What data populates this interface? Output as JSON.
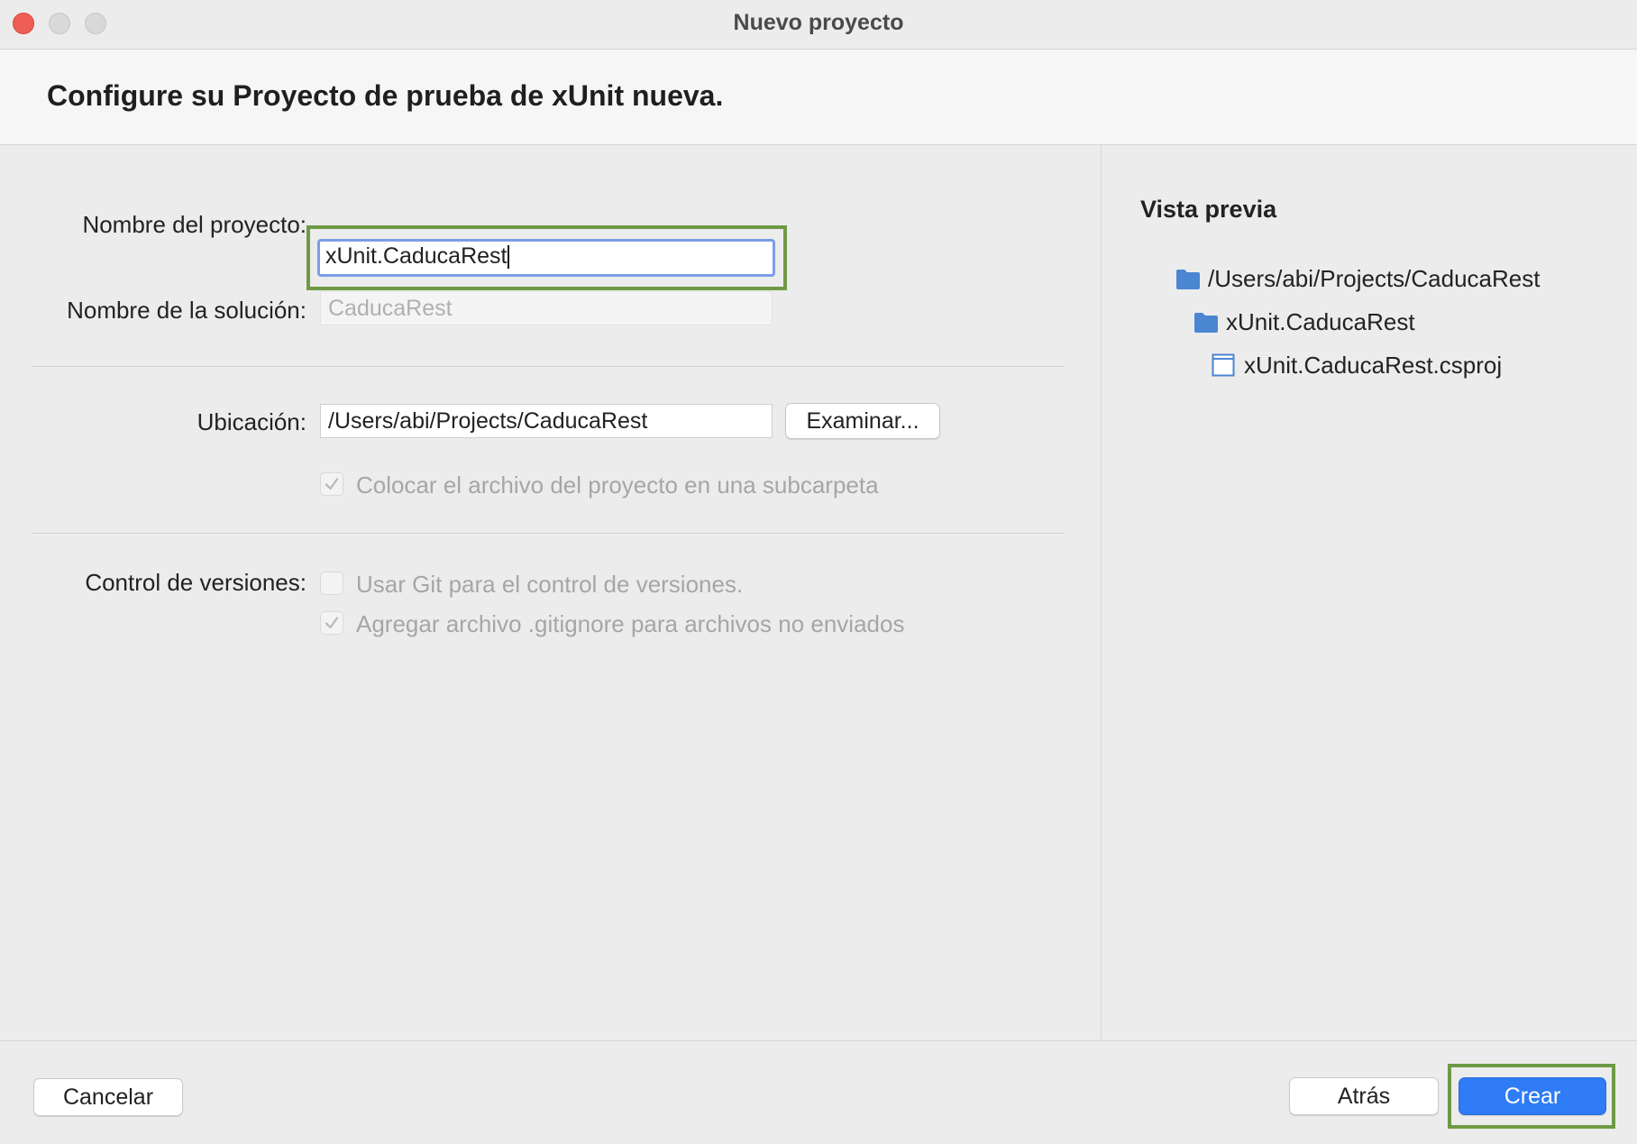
{
  "window": {
    "title": "Nuevo proyecto"
  },
  "header": {
    "title": "Configure su Proyecto de prueba de xUnit nueva."
  },
  "form": {
    "project_name_label": "Nombre del proyecto:",
    "project_name_value": "xUnit.CaducaRest",
    "solution_name_label": "Nombre de la solución:",
    "solution_name_value": "CaducaRest",
    "location_label": "Ubicación:",
    "location_value": "/Users/abi/Projects/CaducaRest",
    "browse_button": "Examinar...",
    "subfolder_checkbox": {
      "label": "Colocar el archivo del proyecto en una subcarpeta",
      "checked": true,
      "enabled": false
    },
    "version_control_label": "Control de versiones:",
    "git_checkbox": {
      "label": "Usar Git para el control de versiones.",
      "checked": false,
      "enabled": false
    },
    "gitignore_checkbox": {
      "label": "Agregar archivo .gitignore para archivos no enviados",
      "checked": true,
      "enabled": false
    }
  },
  "preview": {
    "title": "Vista previa",
    "items": [
      {
        "label": "/Users/abi/Projects/CaducaRest",
        "icon": "folder-icon"
      },
      {
        "label": "xUnit.CaducaRest",
        "icon": "folder-icon"
      },
      {
        "label": "xUnit.CaducaRest.csproj",
        "icon": "file-icon"
      }
    ]
  },
  "footer": {
    "cancel_button": "Cancelar",
    "back_button": "Atrás",
    "create_button": "Crear"
  },
  "colors": {
    "accent": "#2f7cf6",
    "highlight": "#6f9a45",
    "focus_ring": "#7a9ee8",
    "folder": "#4a86d1"
  }
}
